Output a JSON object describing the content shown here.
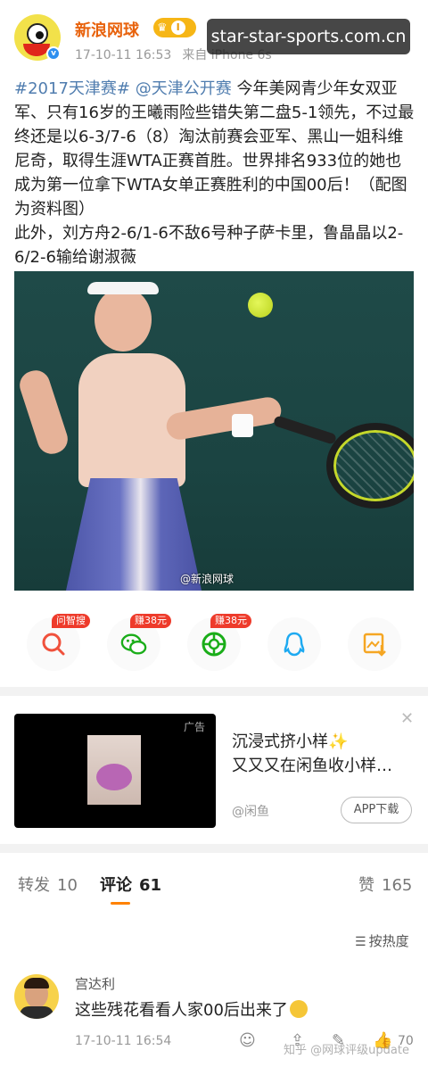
{
  "header": {
    "username": "新浪网球",
    "vip_level": "I",
    "timestamp": "17-10-11 16:53",
    "source": "来自 iPhone 6s",
    "overlay_watermark": "star-star-sports.com.cn"
  },
  "post": {
    "hashtag1": "#2017天津赛#",
    "mention": "@天津公开赛",
    "text1": "今年美网青少年女双亚军、只有16岁的王曦雨险些错失第二盘5-1领先，不过最终还是以6-3/7-6（8）淘汰前赛会亚军、黑山一姐科维尼奇，取得生涯WTA正赛首胜。世界排名933位的她也成为第一位拿下WTA女单正赛胜利的中国00后！（配图为资料图）",
    "text2": "此外，刘方舟2-6/1-6不敌6号种子萨卡里，鲁晶晶以2-6/2-6输给谢淑薇",
    "image_credit": "@新浪网球"
  },
  "share": {
    "items": [
      {
        "name": "zhisou",
        "badge": "问智搜",
        "icon": "search-icon",
        "color": "#f0513c"
      },
      {
        "name": "wechat",
        "badge": "赚38元",
        "icon": "wechat-icon",
        "color": "#1aad19"
      },
      {
        "name": "moments",
        "badge": "赚38元",
        "icon": "moments-icon",
        "color": "#1aad19"
      },
      {
        "name": "qq",
        "badge": "",
        "icon": "qq-icon",
        "color": "#1eaaf1"
      },
      {
        "name": "save-image",
        "badge": "",
        "icon": "image-save-icon",
        "color": "#f5a623"
      }
    ]
  },
  "ad": {
    "tag": "广告",
    "title_line1": "沉浸式挤小样✨",
    "title_line2": "又又又在闲鱼收小样…",
    "brand": "@闲鱼",
    "button": "APP下载",
    "close": "✕"
  },
  "tabs": {
    "repost_label": "转发",
    "repost_count": "10",
    "comment_label": "评论",
    "comment_count": "61",
    "like_label": "赞",
    "like_count": "165"
  },
  "sort": {
    "label": "按热度"
  },
  "comment": {
    "username": "宫达利",
    "text": "这些残花看看人家00后出来了",
    "time": "17-10-11 16:54",
    "like_count": "70"
  },
  "bottom_watermark": "知乎 @网球评级update"
}
